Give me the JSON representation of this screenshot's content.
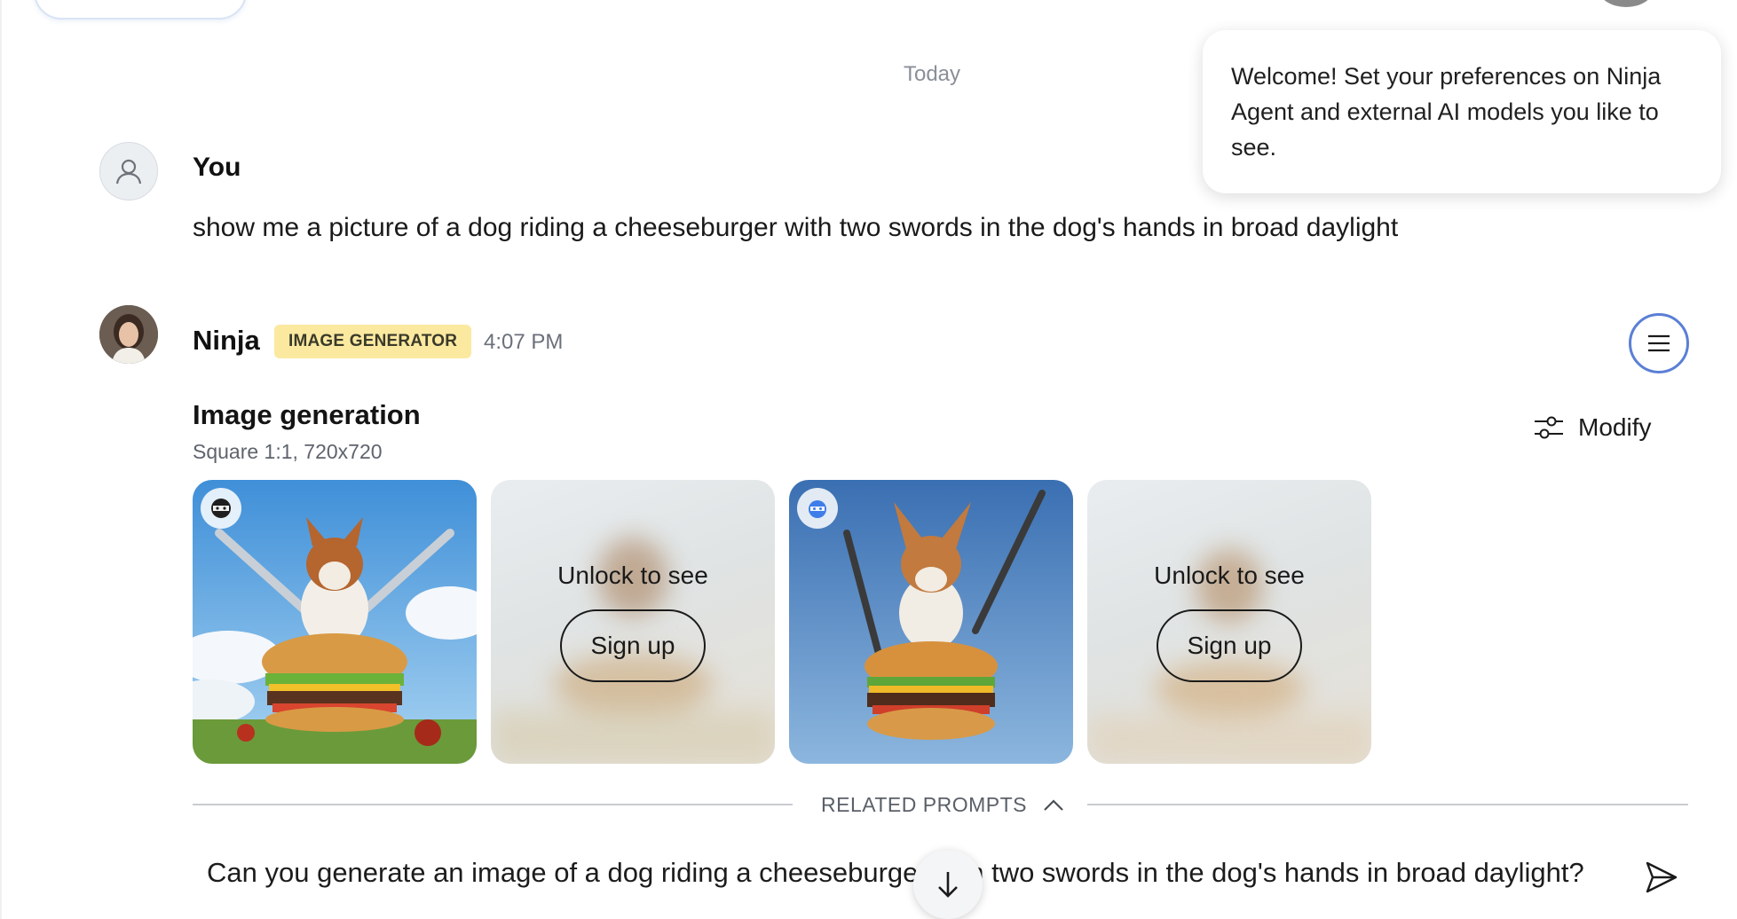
{
  "date_separator": "Today",
  "welcome_tooltip": {
    "text": "Welcome! Set your preferences on Ninja Agent and external AI models you like to see."
  },
  "user_message": {
    "author": "You",
    "avatar_icon": "user-icon",
    "text": "show me a picture of a dog riding a cheeseburger with two swords in the dog's hands in broad daylight"
  },
  "ninja_message": {
    "author": "Ninja",
    "badge": "IMAGE GENERATOR",
    "time": "4:07 PM",
    "menu_icon": "hamburger-menu-icon",
    "image_generation": {
      "title": "Image generation",
      "subtitle": "Square 1:1, 720x720",
      "modify_label": "Modify",
      "modify_icon": "sliders-icon",
      "images": [
        {
          "locked": false,
          "model_icon": "ninja-model-icon"
        },
        {
          "locked": true,
          "unlock_text": "Unlock to see",
          "button": "Sign up"
        },
        {
          "locked": false,
          "model_icon": "external-model-icon"
        },
        {
          "locked": true,
          "unlock_text": "Unlock to see",
          "button": "Sign up"
        }
      ]
    }
  },
  "related_prompts": {
    "label": "RELATED PROMPTS",
    "toggle_icon": "chevron-up-icon",
    "items": [
      "Can you generate an image of a dog riding a cheeseburger with two swords in the dog's hands in broad daylight?"
    ],
    "send_icon": "send-icon"
  },
  "scroll_down_icon": "arrow-down-icon",
  "colors": {
    "badge_bg": "#fbe9a0",
    "menu_ring": "#5b7fd6",
    "divider": "#c9ccd1"
  }
}
